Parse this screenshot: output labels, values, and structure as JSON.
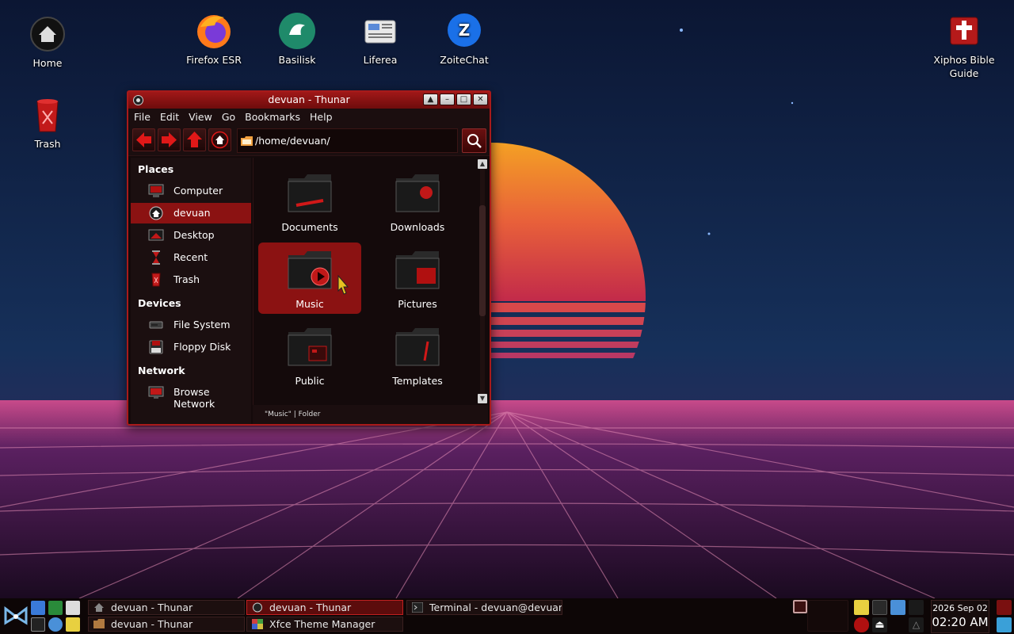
{
  "desktop": {
    "icons": [
      {
        "label": "Home"
      },
      {
        "label": "Firefox ESR"
      },
      {
        "label": "Basilisk"
      },
      {
        "label": "Liferea"
      },
      {
        "label": "ZoiteChat"
      },
      {
        "label": "Xiphos Bible Guide"
      },
      {
        "label": "Trash"
      }
    ]
  },
  "window": {
    "title": "devuan - Thunar",
    "menu": [
      "File",
      "Edit",
      "View",
      "Go",
      "Bookmarks",
      "Help"
    ],
    "location": "/home/devuan/",
    "sidebar": {
      "places_header": "Places",
      "places": [
        {
          "label": "Computer",
          "icon": "computer-icon"
        },
        {
          "label": "devuan",
          "icon": "home-icon",
          "selected": true
        },
        {
          "label": "Desktop",
          "icon": "desktop-icon"
        },
        {
          "label": "Recent",
          "icon": "hourglass-icon"
        },
        {
          "label": "Trash",
          "icon": "trash-icon"
        }
      ],
      "devices_header": "Devices",
      "devices": [
        {
          "label": "File System",
          "icon": "drive-icon"
        },
        {
          "label": "Floppy Disk",
          "icon": "floppy-icon"
        }
      ],
      "network_header": "Network",
      "network": [
        {
          "label": "Browse Network",
          "icon": "network-icon"
        }
      ]
    },
    "files": [
      {
        "label": "Documents"
      },
      {
        "label": "Downloads"
      },
      {
        "label": "Music",
        "selected": true
      },
      {
        "label": "Pictures"
      },
      {
        "label": "Public"
      },
      {
        "label": "Templates"
      }
    ],
    "status": "\"Music\"  |  Folder"
  },
  "taskbar": {
    "tasks": [
      {
        "label": "devuan - Thunar"
      },
      {
        "label": "devuan - Thunar"
      },
      {
        "label": "devuan - Thunar",
        "active": true
      },
      {
        "label": "Xfce Theme Manager"
      },
      {
        "label": "Terminal - devuan@devuan: ~"
      }
    ],
    "clock": {
      "date": "2026 Sep 02",
      "time": "02:20 AM"
    }
  },
  "colors": {
    "accent": "#8b1212",
    "border": "#a81a1a",
    "window_bg": "#140a0b"
  }
}
